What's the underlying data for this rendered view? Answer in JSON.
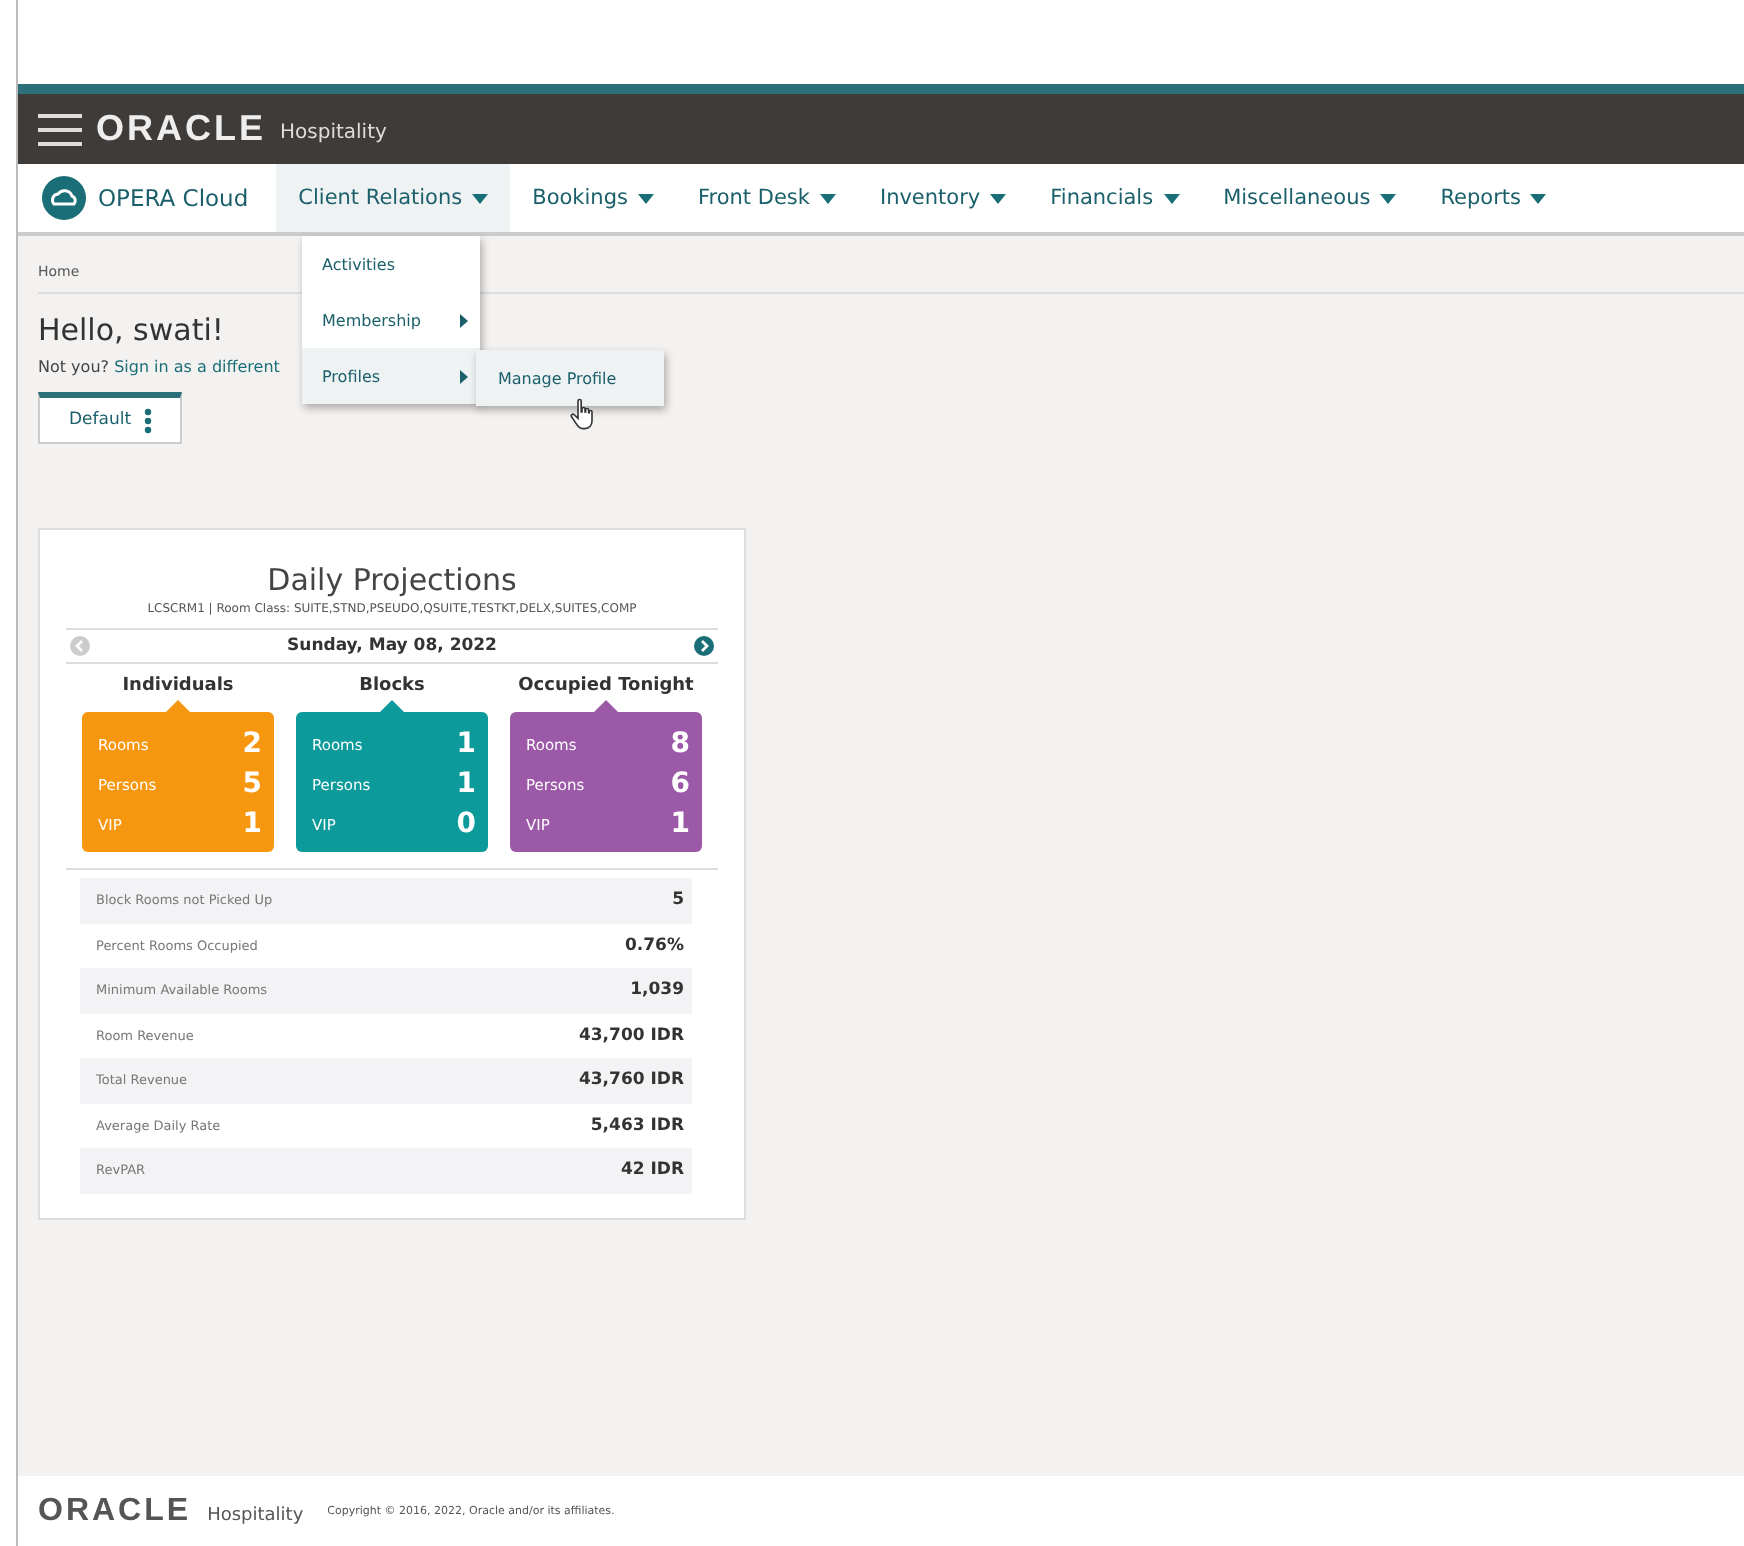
{
  "header": {
    "brand": "ORACLE",
    "product": "Hospitality"
  },
  "nav": {
    "app_name": "OPERA Cloud",
    "items": [
      {
        "label": "Client Relations",
        "selected": true
      },
      {
        "label": "Bookings",
        "selected": false
      },
      {
        "label": "Front Desk",
        "selected": false
      },
      {
        "label": "Inventory",
        "selected": false
      },
      {
        "label": "Financials",
        "selected": false
      },
      {
        "label": "Miscellaneous",
        "selected": false
      },
      {
        "label": "Reports",
        "selected": false
      }
    ]
  },
  "menu": {
    "items": [
      {
        "label": "Activities",
        "has_submenu": false,
        "selected": false
      },
      {
        "label": "Membership",
        "has_submenu": true,
        "selected": false
      },
      {
        "label": "Profiles",
        "has_submenu": true,
        "selected": true
      }
    ],
    "submenu": [
      {
        "label": "Manage Profile",
        "selected": true
      }
    ]
  },
  "breadcrumb": "Home",
  "greeting": "Hello, swati!",
  "not_you": {
    "prefix": "Not you?",
    "link": "Sign in as a different"
  },
  "dashboard_tab": {
    "label": "Default"
  },
  "card": {
    "title": "Daily Projections",
    "subtitle": "LCSCRM1 | Room Class: SUITE,STND,PSEUDO,QSUITE,TESTKT,DELX,SUITES,COMP",
    "date": "Sunday, May 08, 2022",
    "groups": [
      {
        "title": "Individuals",
        "color": "#f7960f",
        "rows": [
          {
            "label": "Rooms",
            "value": "2"
          },
          {
            "label": "Persons",
            "value": "5"
          },
          {
            "label": "VIP",
            "value": "1"
          }
        ]
      },
      {
        "title": "Blocks",
        "color": "#0d9a9a",
        "rows": [
          {
            "label": "Rooms",
            "value": "1"
          },
          {
            "label": "Persons",
            "value": "1"
          },
          {
            "label": "VIP",
            "value": "0"
          }
        ]
      },
      {
        "title": "Occupied Tonight",
        "color": "#9c59a8",
        "rows": [
          {
            "label": "Rooms",
            "value": "8"
          },
          {
            "label": "Persons",
            "value": "6"
          },
          {
            "label": "VIP",
            "value": "1"
          }
        ]
      }
    ],
    "stats": [
      {
        "label": "Block Rooms not Picked Up",
        "value": "5"
      },
      {
        "label": "Percent Rooms Occupied",
        "value": "0.76%"
      },
      {
        "label": "Minimum Available Rooms",
        "value": "1,039"
      },
      {
        "label": "Room Revenue",
        "value": "43,700 IDR"
      },
      {
        "label": "Total Revenue",
        "value": "43,760 IDR"
      },
      {
        "label": "Average Daily Rate",
        "value": "5,463 IDR"
      },
      {
        "label": "RevPAR",
        "value": "42 IDR"
      }
    ]
  },
  "footer": {
    "brand": "ORACLE",
    "product": "Hospitality",
    "copyright": "Copyright © 2016, 2022, Oracle and/or its affiliates."
  }
}
